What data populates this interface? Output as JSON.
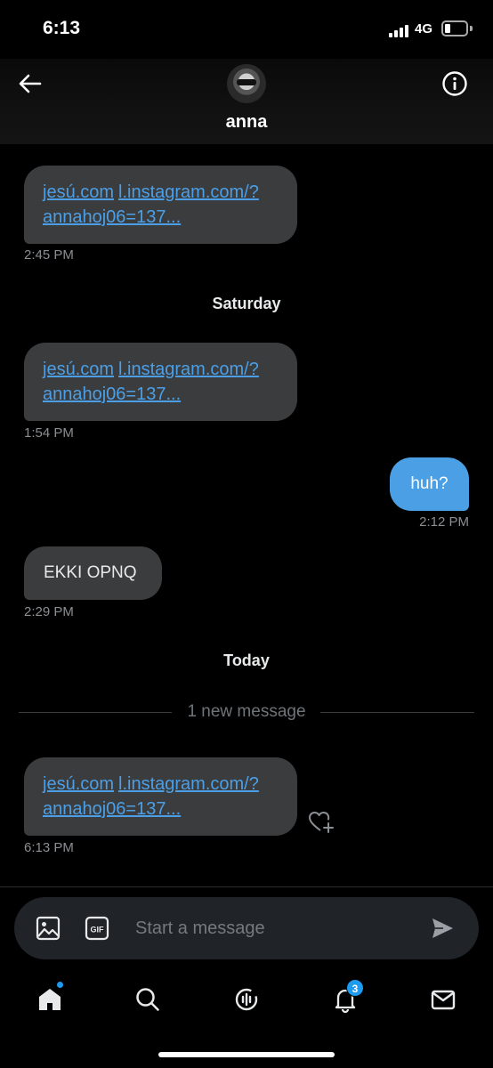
{
  "status_bar": {
    "time": "6:13",
    "network": "4G"
  },
  "header": {
    "contact_name": "anna"
  },
  "messages": [
    {
      "link_parts": [
        "jesú.com",
        "l.instagram.com/?",
        "annahoj06=137..."
      ],
      "time": "2:45 PM"
    },
    {
      "link_parts": [
        "jesú.com",
        "l.instagram.com/?",
        "annahoj06=137..."
      ],
      "time": "1:54 PM"
    },
    {
      "text": "huh?",
      "time": "2:12 PM"
    },
    {
      "text": "EKKI OPNQ",
      "time": "2:29 PM"
    },
    {
      "link_parts": [
        "jesú.com",
        "l.instagram.com/?",
        "annahoj06=137..."
      ],
      "time": "6:13 PM"
    }
  ],
  "day_labels": {
    "saturday": "Saturday",
    "today": "Today"
  },
  "new_message_divider": "1 new message",
  "composer": {
    "placeholder": "Start a message",
    "gif_label": "GIF"
  },
  "tabbar": {
    "notifications_badge": "3"
  },
  "colors": {
    "accent": "#1d9bf0",
    "outgoing_bubble": "#4a9fe5",
    "incoming_bubble": "#3a3c3e",
    "link": "#4c9fe6"
  },
  "icons": [
    "back-arrow-icon",
    "info-icon",
    "image-icon",
    "gif-icon",
    "send-icon",
    "add-reaction-icon",
    "home-icon",
    "search-icon",
    "spaces-icon",
    "notifications-icon",
    "messages-icon"
  ]
}
